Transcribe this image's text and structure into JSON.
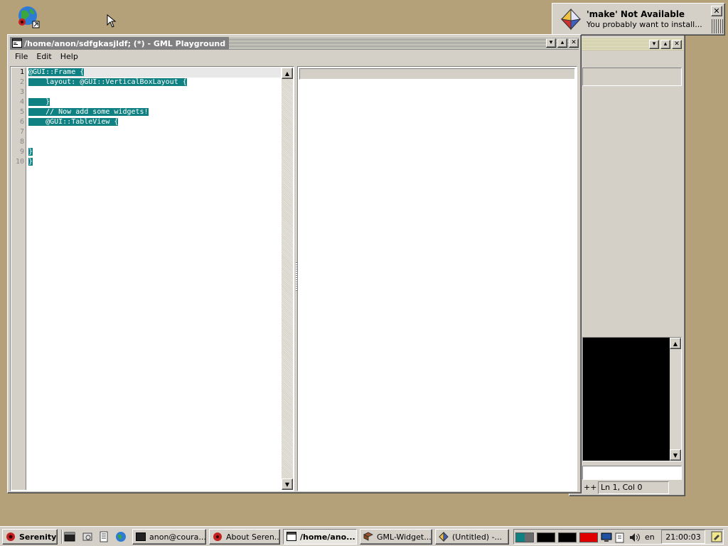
{
  "notification": {
    "title": "'make' Not Available",
    "text": "You probably want to install..."
  },
  "main_window": {
    "title": "/home/anon/sdfgkasjldf; (*) - GML Playground",
    "menu": [
      "File",
      "Edit",
      "Help"
    ],
    "line_numbers": [
      "1",
      "2",
      "3",
      "4",
      "5",
      "6",
      "7",
      "8",
      "9",
      "10"
    ],
    "code_lines": [
      "@GUI::Frame {",
      "    layout: @GUI::VerticalBoxLayout {",
      "",
      "    }",
      "    // Now add some widgets!",
      "    @GUI::TableView {",
      "",
      "",
      "}",
      "}"
    ]
  },
  "background_window": {
    "status_prefix": "++",
    "status_position": "Ln 1, Col 0"
  },
  "taskbar": {
    "start_label": "Serenity",
    "tasks": [
      "anon@coura...",
      "About Seren...",
      "/home/ano...",
      "GML-Widget...",
      "(Untitled) -..."
    ],
    "keyboard_layout": "en",
    "clock": "21:00:03"
  },
  "colors": {
    "desktop": "#b4a17a",
    "selection": "#0f8182",
    "title_active": "#808080"
  }
}
